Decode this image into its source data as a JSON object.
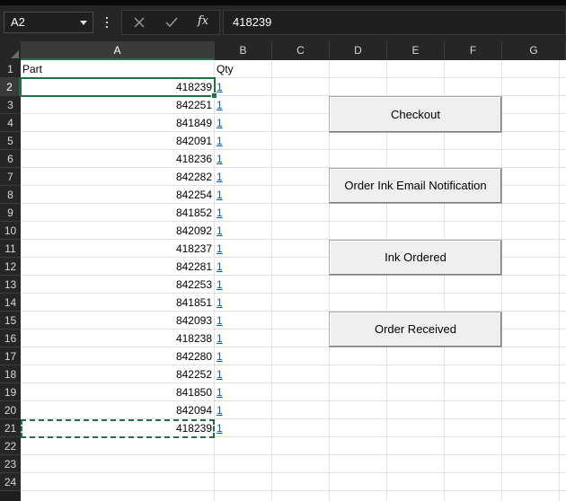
{
  "name_box": "A2",
  "formula_bar": {
    "content": "418239",
    "fx_label": "fx"
  },
  "columns": [
    "A",
    "B",
    "C",
    "D",
    "E",
    "F",
    "G"
  ],
  "rows": [
    "1",
    "2",
    "3",
    "4",
    "5",
    "6",
    "7",
    "8",
    "9",
    "10",
    "11",
    "12",
    "13",
    "14",
    "15",
    "16",
    "17",
    "18",
    "19",
    "20",
    "21",
    "22",
    "23",
    "24"
  ],
  "headers": {
    "part": "Part",
    "qty": "Qty"
  },
  "parts": [
    "418239",
    "842251",
    "841849",
    "842091",
    "418236",
    "842282",
    "842254",
    "841852",
    "842092",
    "418237",
    "842281",
    "842253",
    "841851",
    "842093",
    "418238",
    "842280",
    "842252",
    "841850",
    "842094",
    "418239"
  ],
  "qtys": [
    "1",
    "1",
    "1",
    "1",
    "1",
    "1",
    "1",
    "1",
    "1",
    "1",
    "1",
    "1",
    "1",
    "1",
    "1",
    "1",
    "1",
    "1",
    "1",
    "1"
  ],
  "buttons": {
    "checkout": "Checkout",
    "order_ink_email": "Order Ink Email Notification",
    "ink_ordered": "Ink Ordered",
    "order_received": "Order Received"
  },
  "colors": {
    "selection": "#1e7145",
    "link": "#0563c1",
    "chrome": "#262626"
  }
}
